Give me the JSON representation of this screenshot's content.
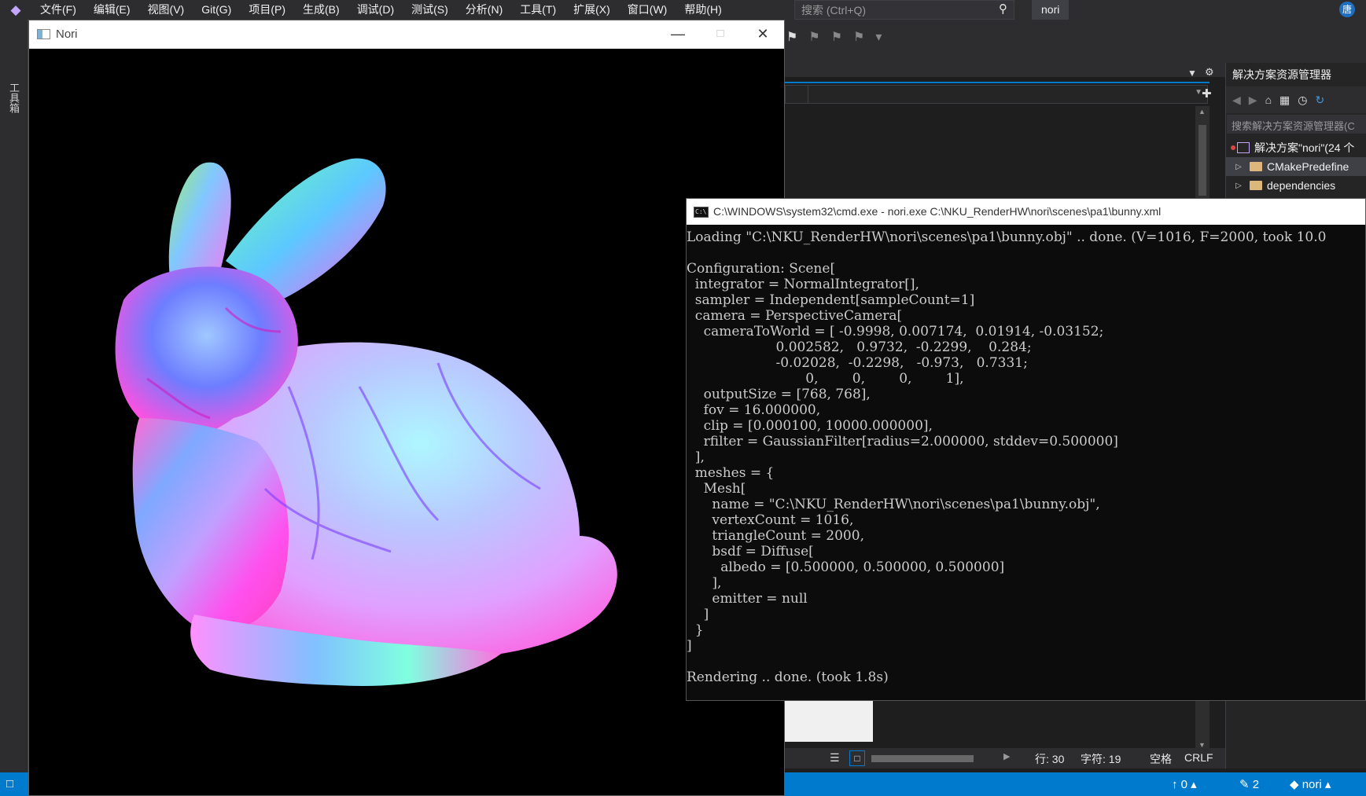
{
  "vs": {
    "menu": [
      "文件(F)",
      "编辑(E)",
      "视图(V)",
      "Git(G)",
      "项目(P)",
      "生成(B)",
      "调试(D)",
      "测试(S)",
      "分析(N)",
      "工具(T)",
      "扩展(X)",
      "窗口(W)",
      "帮助(H)"
    ],
    "search_placeholder": "搜索 (Ctrl+Q)",
    "solution_name": "nori",
    "user_initial": "唐",
    "toolbox_label": "工具箱",
    "accent_color": "#007acc"
  },
  "solution_explorer": {
    "title": "解决方案资源管理器",
    "search_placeholder": "搜索解决方案资源管理器(C",
    "items": [
      {
        "label": "解决方案\"nori\"(24 个"
      },
      {
        "label": "CMakePredefine"
      },
      {
        "label": "dependencies"
      }
    ]
  },
  "editor_status": {
    "line": "行: 30",
    "char": "字符: 19",
    "spaces": "空格",
    "eol": "CRLF"
  },
  "statusbar": {
    "ups": "0",
    "changes": "2",
    "branch": "nori"
  },
  "nori_window": {
    "title": "Nori",
    "image_desc": "normals-shaded Stanford bunny"
  },
  "cmd_window": {
    "title": "C:\\WINDOWS\\system32\\cmd.exe - nori.exe  C:\\NKU_RenderHW\\nori\\scenes\\pa1\\bunny.xml",
    "lines": [
      "Loading \"C:\\NKU_RenderHW\\nori\\scenes\\pa1\\bunny.obj\" .. done. (V=1016, F=2000, took 10.0",
      "",
      "Configuration: Scene[",
      "  integrator = NormalIntegrator[],",
      "  sampler = Independent[sampleCount=1]",
      "  camera = PerspectiveCamera[",
      "    cameraToWorld = [ -0.9998, 0.007174,  0.01914, -0.03152;",
      "                     0.002582,   0.9732,  -0.2299,    0.284;",
      "                     -0.02028,  -0.2298,   -0.973,   0.7331;",
      "                            0,        0,        0,        1],",
      "    outputSize = [768, 768],",
      "    fov = 16.000000,",
      "    clip = [0.000100, 10000.000000],",
      "    rfilter = GaussianFilter[radius=2.000000, stddev=0.500000]",
      "  ],",
      "  meshes = {",
      "    Mesh[",
      "      name = \"C:\\NKU_RenderHW\\nori\\scenes\\pa1\\bunny.obj\",",
      "      vertexCount = 1016,",
      "      triangleCount = 2000,",
      "      bsdf = Diffuse[",
      "        albedo = [0.500000, 0.500000, 0.500000]",
      "      ],",
      "      emitter = null",
      "    ]",
      "  }",
      "]",
      "",
      "Rendering .. done. (took 1.8s)"
    ]
  }
}
